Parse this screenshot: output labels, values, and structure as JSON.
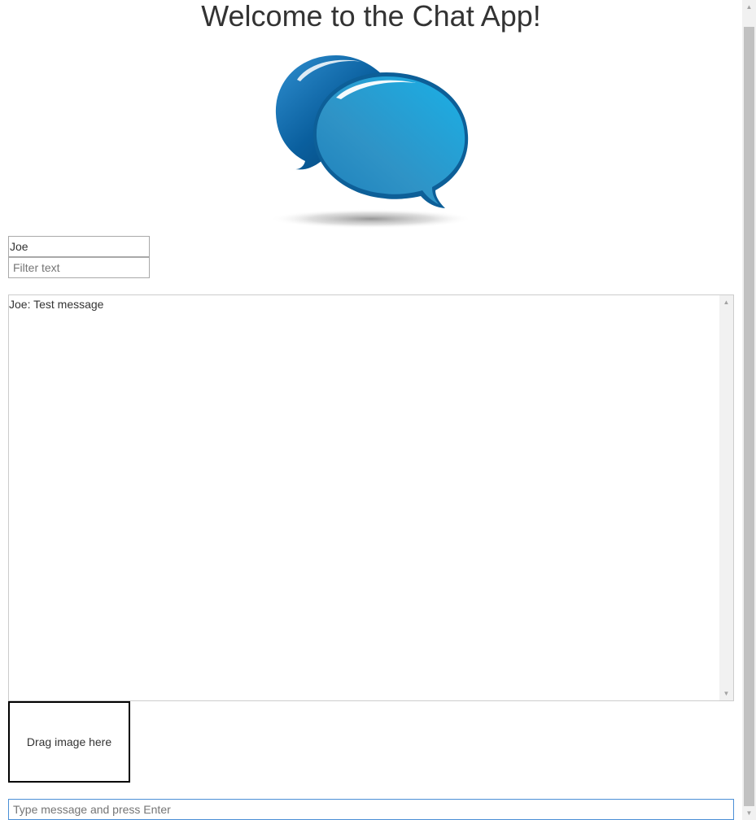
{
  "header": {
    "title": "Welcome to the Chat App!"
  },
  "logo": {
    "icon": "chat-bubbles-logo",
    "colors": {
      "dark_bubble": "#0a5f9e",
      "light_bubble": "#2a9fd6"
    }
  },
  "name_field": {
    "value": "Joe",
    "placeholder": ""
  },
  "filter_field": {
    "value": "",
    "placeholder": "Filter text"
  },
  "chat_log": {
    "messages": [
      {
        "text": "Joe: Test message"
      }
    ]
  },
  "dropzone": {
    "label": "Drag image here"
  },
  "message_field": {
    "value": "",
    "placeholder": "Type message and press Enter",
    "focus_color": "#4b8fd6"
  },
  "scrollbar": {
    "up_icon": "arrow-up-icon",
    "down_icon": "arrow-down-icon"
  }
}
